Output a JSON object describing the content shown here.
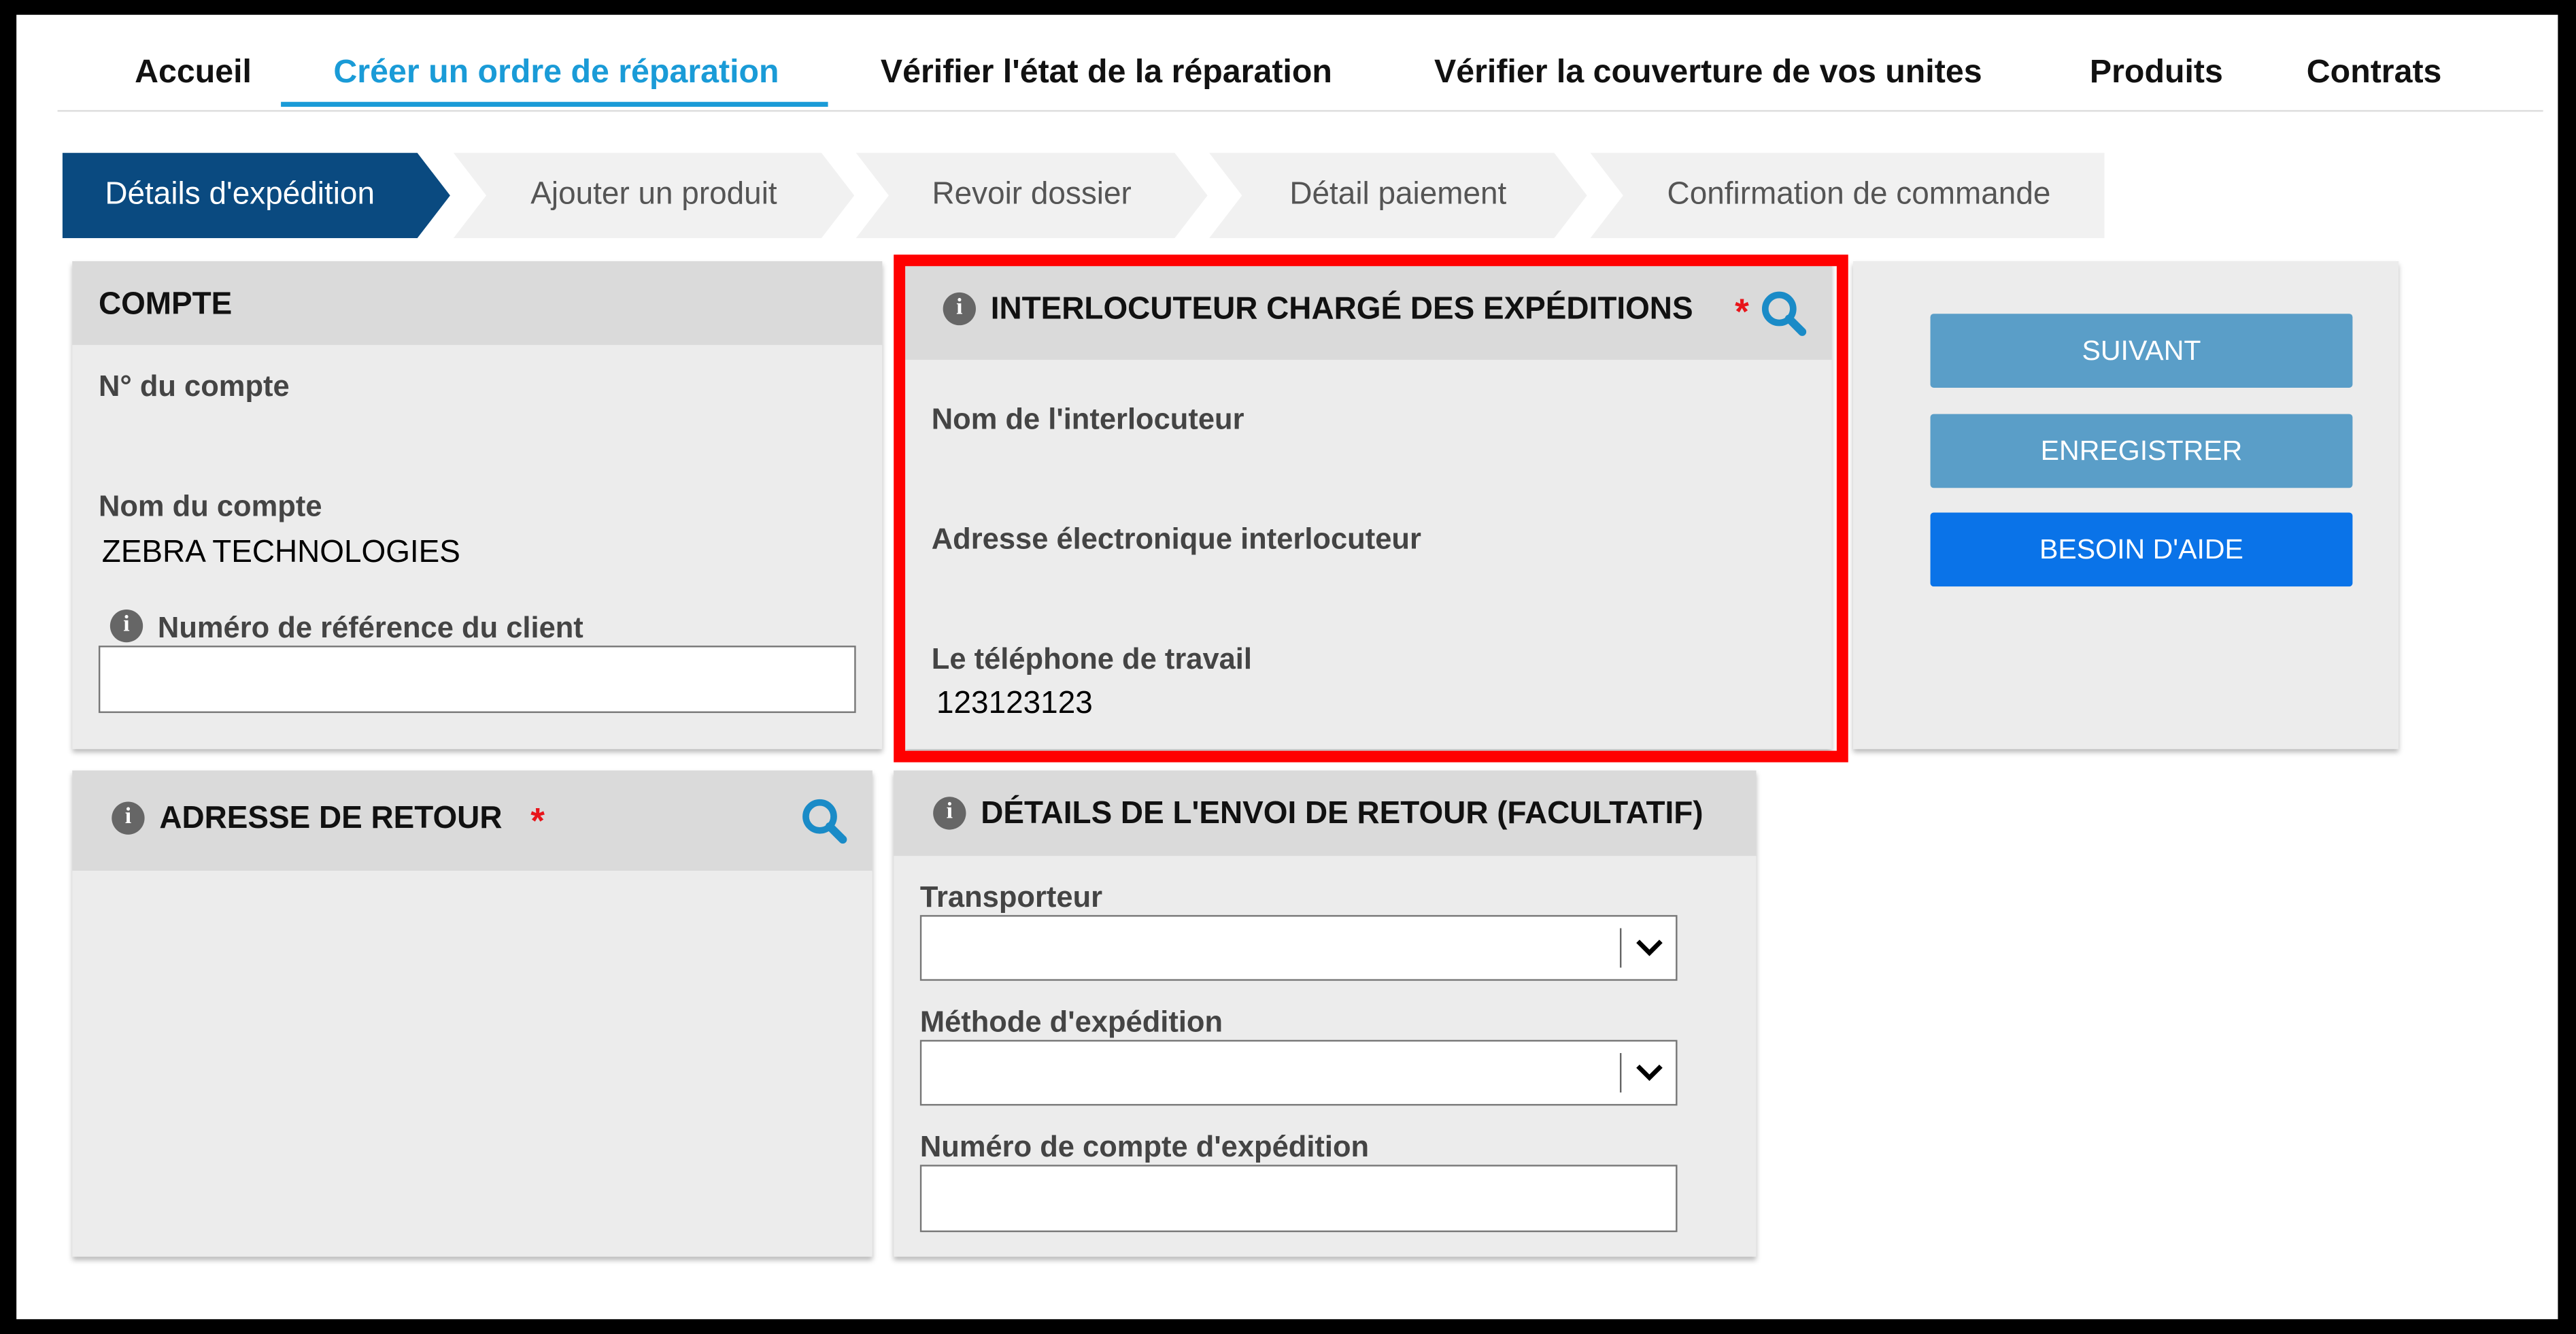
{
  "nav": {
    "items": [
      {
        "label": "Accueil"
      },
      {
        "label": "Créer un ordre de réparation"
      },
      {
        "label": "Vérifier l'état de la réparation"
      },
      {
        "label": "Vérifier la couverture de vos unites"
      },
      {
        "label": "Produits"
      },
      {
        "label": "Contrats"
      }
    ],
    "active_index": 1
  },
  "steps": [
    {
      "label": "Détails d'expédition",
      "active": true
    },
    {
      "label": "Ajouter un produit",
      "active": false
    },
    {
      "label": "Revoir dossier",
      "active": false
    },
    {
      "label": "Détail paiement",
      "active": false
    },
    {
      "label": "Confirmation de commande",
      "active": false
    }
  ],
  "account": {
    "title": "COMPTE",
    "number_label": "N° du compte",
    "number_value": "",
    "name_label": "Nom du compte",
    "name_value": "ZEBRA TECHNOLOGIES",
    "ref_label": "Numéro de référence du client",
    "ref_value": ""
  },
  "contact": {
    "title": "INTERLOCUTEUR CHARGÉ DES EXPÉDITIONS",
    "required_mark": "*",
    "name_label": "Nom de l'interlocuteur",
    "name_value": "",
    "email_label": "Adresse électronique interlocuteur",
    "email_value": "",
    "phone_label": "Le téléphone de travail",
    "phone_value": "123123123"
  },
  "actions": {
    "next_label": "SUIVANT",
    "save_label": "ENREGISTRER",
    "help_label": "BESOIN D'AIDE"
  },
  "return_address": {
    "title": "ADRESSE DE RETOUR",
    "required_mark": "*"
  },
  "return_shipping": {
    "title": "DÉTAILS DE L'ENVOI DE RETOUR (FACULTATIF)",
    "carrier_label": "Transporteur",
    "carrier_value": "",
    "method_label": "Méthode d'expédition",
    "method_value": "",
    "account_label": "Numéro de compte d'expédition",
    "account_value": ""
  },
  "icons": {
    "info": "info-icon",
    "search": "search-icon",
    "dropdown": "chevron-down-icon"
  },
  "colors": {
    "nav_active": "#1a9bd7",
    "step_active_bg": "#0a4a80",
    "step_inactive_bg": "#f1f1f1",
    "button_secondary": "#5a9ec8",
    "button_primary": "#0a73e8",
    "required": "#e8151b",
    "search_icon": "#1a8bc7",
    "highlight_border": "#ff0000"
  }
}
